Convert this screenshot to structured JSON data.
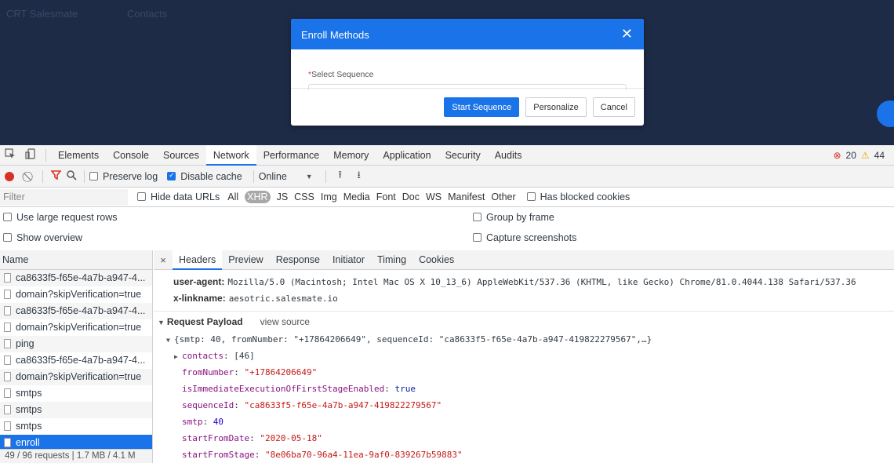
{
  "app_background": {
    "ghost_texts": [
      "CRT Salesmate",
      "Contacts"
    ]
  },
  "modal": {
    "title": "Enroll Methods",
    "close_glyph": "✕",
    "field_label": "Select Sequence",
    "required_mark": "*",
    "buttons": {
      "start": "Start Sequence",
      "personalize": "Personalize",
      "cancel": "Cancel"
    }
  },
  "devtools": {
    "tabs": [
      "Elements",
      "Console",
      "Sources",
      "Network",
      "Performance",
      "Memory",
      "Application",
      "Security",
      "Audits"
    ],
    "active_tab": "Network",
    "errors": "20",
    "warnings": "44",
    "toolbar": {
      "preserve_log": "Preserve log",
      "disable_cache": "Disable cache",
      "throttle": "Online"
    },
    "filter": {
      "placeholder": "Filter",
      "hide_data_urls": "Hide data URLs",
      "types": [
        "All",
        "XHR",
        "JS",
        "CSS",
        "Img",
        "Media",
        "Font",
        "Doc",
        "WS",
        "Manifest",
        "Other"
      ],
      "active_type": "XHR",
      "blocked": "Has blocked cookies"
    },
    "options": {
      "large_rows": "Use large request rows",
      "overview": "Show overview",
      "group_by_frame": "Group by frame",
      "capture": "Capture screenshots"
    },
    "requests": {
      "header": "Name",
      "rows": [
        "ca8633f5-f65e-4a7b-a947-4...",
        "domain?skipVerification=true",
        "ca8633f5-f65e-4a7b-a947-4...",
        "domain?skipVerification=true",
        "ping",
        "ca8633f5-f65e-4a7b-a947-4...",
        "domain?skipVerification=true",
        "smtps",
        "smtps",
        "smtps",
        "enroll"
      ],
      "selected": "enroll",
      "footer": "49 / 96 requests  |  1.7 MB / 4.1 M"
    },
    "detail": {
      "close": "×",
      "tabs": [
        "Headers",
        "Preview",
        "Response",
        "Initiator",
        "Timing",
        "Cookies"
      ],
      "active_tab": "Headers",
      "headers": [
        {
          "name": "user-agent:",
          "value": "Mozilla/5.0 (Macintosh; Intel Mac OS X 10_13_6) AppleWebKit/537.36 (KHTML, like Gecko) Chrome/81.0.4044.138 Safari/537.36"
        },
        {
          "name": "x-linkname:",
          "value": "aesotric.salesmate.io"
        }
      ],
      "payload_title": "Request Payload",
      "view_source": "view source",
      "summary": "{smtp: 40, fromNumber: \"+17864206649\", sequenceId: \"ca8633f5-f65e-4a7b-a947-419822279567\",…}",
      "contacts_key": "contacts",
      "contacts_val": "[46]",
      "fields": [
        {
          "key": "fromNumber",
          "value": "\"+17864206649\"",
          "type": "s"
        },
        {
          "key": "isImmediateExecutionOfFirstStageEnabled",
          "value": "true",
          "type": "b"
        },
        {
          "key": "sequenceId",
          "value": "\"ca8633f5-f65e-4a7b-a947-419822279567\"",
          "type": "s"
        },
        {
          "key": "smtp",
          "value": "40",
          "type": "n"
        },
        {
          "key": "startFromDate",
          "value": "\"2020-05-18\"",
          "type": "s"
        },
        {
          "key": "startFromStage",
          "value": "\"8e06ba70-96a4-11ea-9af0-839267b59883\"",
          "type": "s"
        }
      ]
    }
  }
}
